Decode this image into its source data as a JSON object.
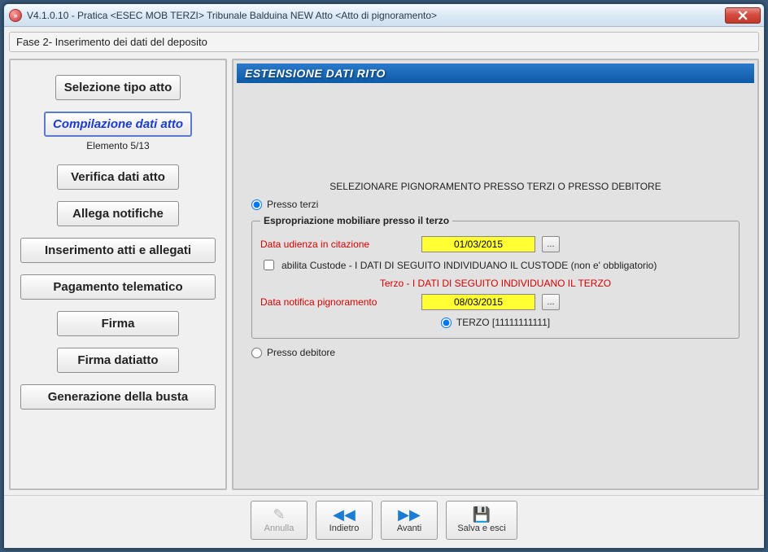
{
  "window": {
    "title": "V4.1.0.10 - Pratica <ESEC MOB TERZI>   Tribunale Balduina NEW   Atto <Atto di pignoramento>"
  },
  "phase": "Fase 2- Inserimento dei dati del deposito",
  "sidebar": {
    "steps": [
      "Selezione tipo atto",
      "Compilazione dati atto",
      "Verifica dati atto",
      "Allega notifiche",
      "Inserimento atti e allegati",
      "Pagamento telematico",
      "Firma",
      "Firma datiatto",
      "Generazione della busta"
    ],
    "active_index": 1,
    "sub_label": "Elemento 5/13"
  },
  "main": {
    "header": "ESTENSIONE DATI RITO",
    "instruction": "SELEZIONARE PIGNORAMENTO PRESSO TERZI O PRESSO DEBITORE",
    "radio_terzi": "Presso terzi",
    "radio_debitore": "Presso debitore",
    "group_legend": "Espropriazione mobiliare presso il terzo",
    "data_udienza_label": "Data udienza in citazione",
    "data_udienza_value": "01/03/2015",
    "custode_label": "abilita Custode - I DATI DI SEGUITO INDIVIDUANO IL CUSTODE (non e' obbligatorio)",
    "terzo_note": "Terzo - I DATI DI SEGUITO INDIVIDUANO IL TERZO",
    "data_notifica_label": "Data notifica pignoramento",
    "data_notifica_value": "08/03/2015",
    "terzo_radio": "TERZO [11111111111]",
    "picker_label": "..."
  },
  "footer": {
    "annulla": "Annulla",
    "indietro": "Indietro",
    "avanti": "Avanti",
    "salva": "Salva e esci"
  }
}
